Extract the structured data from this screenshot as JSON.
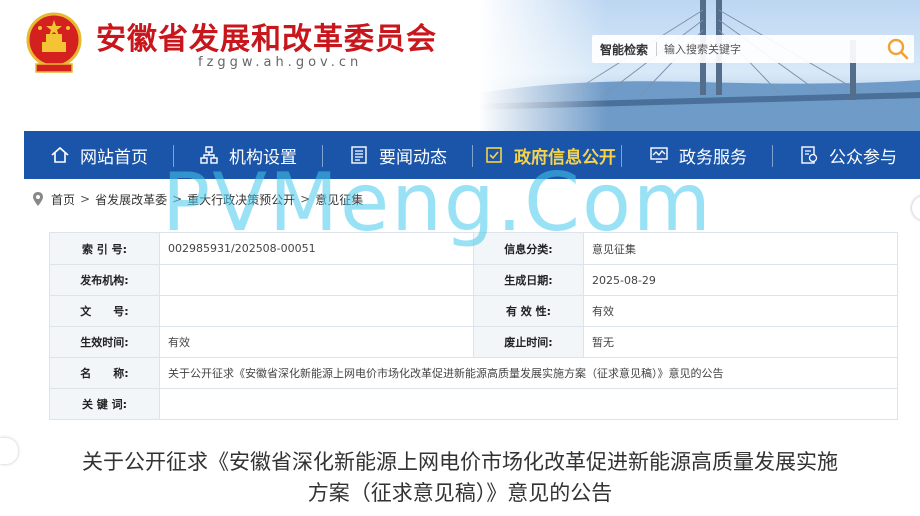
{
  "header": {
    "site_title": "安徽省发展和改革委员会",
    "site_domain": "fzggw.ah.gov.cn",
    "search_label": "智能检索",
    "search_placeholder": "输入搜索关键字"
  },
  "nav": {
    "items": [
      {
        "label": "网站首页",
        "icon": "home-icon"
      },
      {
        "label": "机构设置",
        "icon": "org-chart-icon"
      },
      {
        "label": "要闻动态",
        "icon": "news-icon"
      },
      {
        "label": "政府信息公开",
        "icon": "info-disclosure-icon",
        "active": true
      },
      {
        "label": "政务服务",
        "icon": "monitor-icon"
      },
      {
        "label": "公众参与",
        "icon": "participation-icon"
      }
    ]
  },
  "breadcrumb": [
    "首页",
    "省发展改革委",
    "重大行政决策预公开",
    "意见征集"
  ],
  "info": {
    "index_no_label": "索 引 号:",
    "index_no": "002985931/202508-00051",
    "category_label": "信息分类:",
    "category": "意见征集",
    "publisher_label": "发布机构:",
    "publisher": "",
    "created_label": "生成日期:",
    "created": "2025-08-29",
    "doc_no_label": "文　　号:",
    "doc_no": "",
    "validity_label": "有 效 性:",
    "validity": "有效",
    "effective_label": "生效时间:",
    "effective": "有效",
    "abolish_label": "废止时间:",
    "abolish": "暂无",
    "name_label": "名　　称:",
    "name": "关于公开征求《安徽省深化新能源上网电价市场化改革促进新能源高质量发展实施方案（征求意见稿）》意见的公告",
    "keywords_label": "关 键 词:",
    "keywords": ""
  },
  "doc_title_line1": "关于公开征求《安徽省深化新能源上网电价市场化改革促进新能源高质量发展实施",
  "doc_title_line2": "方案（征求意见稿）》意见的公告",
  "watermark": "PVMeng.Com",
  "colors": {
    "brand_red": "#c8161d",
    "nav_blue": "#1b55a9",
    "nav_active": "#f7d34a",
    "search_orange": "#f2a233"
  }
}
